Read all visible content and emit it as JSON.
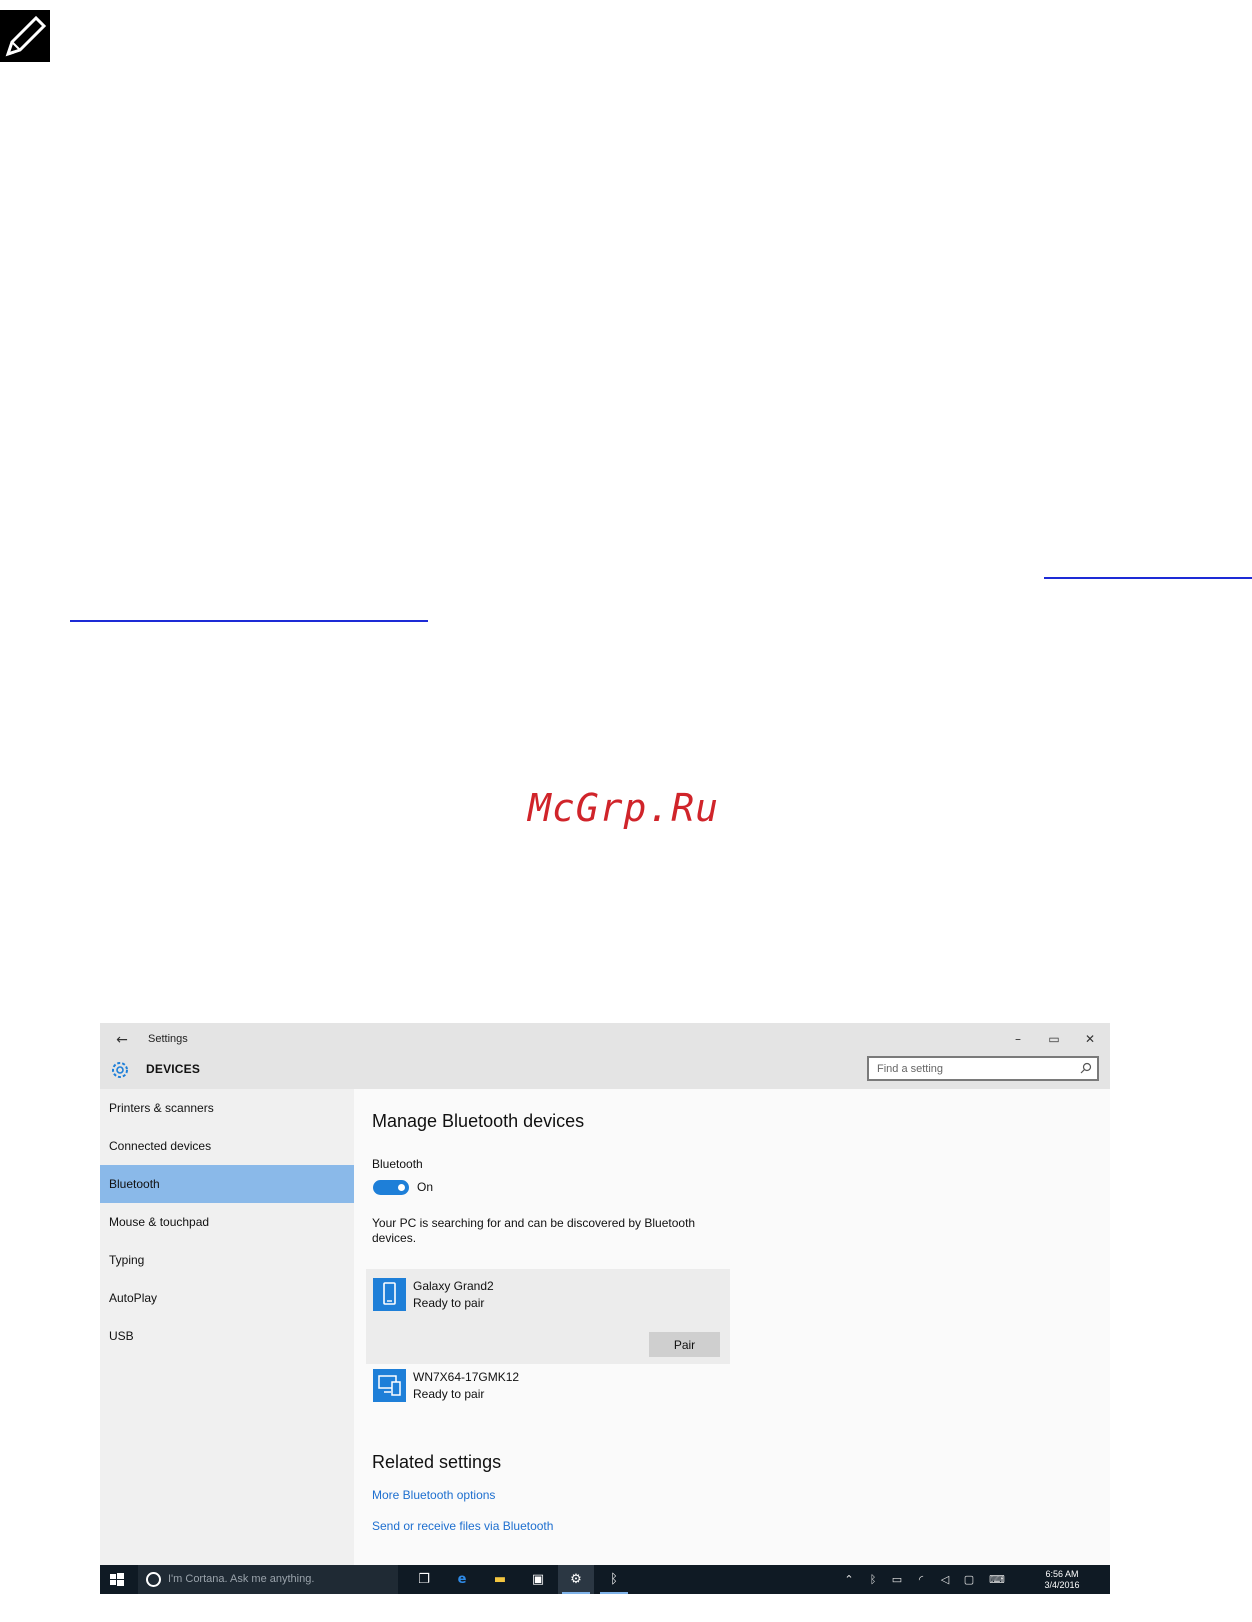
{
  "doc": {
    "note_icon": "pencil-note-icon",
    "watermark": "McGrp.Ru"
  },
  "window": {
    "title": "Settings",
    "section": "DEVICES",
    "search_placeholder": "Find a setting",
    "controls": {
      "minimize": "–",
      "maximize": "▭",
      "close": "✕"
    }
  },
  "sidebar": {
    "items": [
      {
        "label": "Printers & scanners"
      },
      {
        "label": "Connected devices"
      },
      {
        "label": "Bluetooth"
      },
      {
        "label": "Mouse & touchpad"
      },
      {
        "label": "Typing"
      },
      {
        "label": "AutoPlay"
      },
      {
        "label": "USB"
      }
    ],
    "active": "Bluetooth"
  },
  "main": {
    "heading": "Manage Bluetooth devices",
    "bluetooth_label": "Bluetooth",
    "toggle_state": "On",
    "description": "Your PC is searching for and can be discovered by Bluetooth devices.",
    "devices": [
      {
        "name": "Galaxy Grand2",
        "status": "Ready to pair",
        "icon": "phone-icon"
      },
      {
        "name": "WN7X64-17GMK12",
        "status": "Ready to pair",
        "icon": "computer-icon"
      }
    ],
    "pair_label": "Pair",
    "related_heading": "Related settings",
    "links": [
      "More Bluetooth options",
      "Send or receive files via Bluetooth"
    ]
  },
  "taskbar": {
    "cortana_placeholder": "I'm Cortana. Ask me anything.",
    "time": "6:56 AM",
    "date": "3/4/2016"
  },
  "colors": {
    "accent": "#1e7fd8",
    "selected_nav": "#8ab9e9",
    "link": "#1e6fcf",
    "taskbar": "#0f1a24",
    "watermark": "#d0242a",
    "doc_link": "#1d2bd6"
  }
}
